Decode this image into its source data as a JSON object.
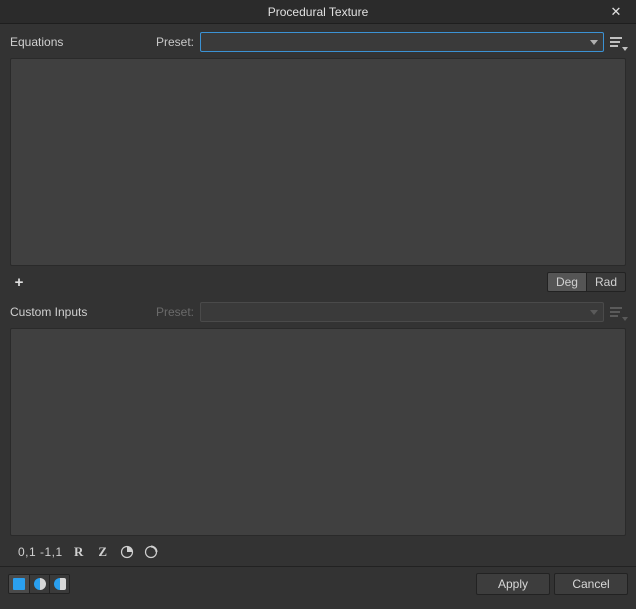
{
  "window": {
    "title": "Procedural Texture",
    "close_icon": "✕"
  },
  "equations": {
    "label": "Equations",
    "preset_label": "Preset:",
    "preset_value": "",
    "add_icon": "+",
    "angle_deg": "Deg",
    "angle_rad": "Rad"
  },
  "custom": {
    "label": "Custom Inputs",
    "preset_label": "Preset:",
    "preset_value": ""
  },
  "status": {
    "range": "0,1  -1,1",
    "r_label": "R",
    "z_label": "Z"
  },
  "footer": {
    "apply": "Apply",
    "cancel": "Cancel"
  }
}
